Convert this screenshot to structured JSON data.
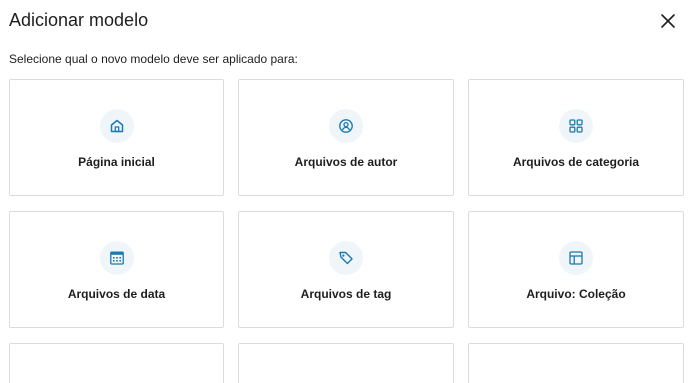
{
  "modal": {
    "title": "Adicionar modelo",
    "close_icon": "close-icon",
    "subtitle": "Selecione qual o novo modelo deve ser aplicado para:"
  },
  "colors": {
    "icon_accent": "#1a7bb0",
    "icon_background": "#eff5f9",
    "card_border": "#dcdcde",
    "text": "#1e1e1e"
  },
  "templates": [
    {
      "label": "Página inicial",
      "icon": "home-icon"
    },
    {
      "label": "Arquivos de autor",
      "icon": "user-icon"
    },
    {
      "label": "Arquivos de categoria",
      "icon": "category-icon"
    },
    {
      "label": "Arquivos de data",
      "icon": "calendar-icon"
    },
    {
      "label": "Arquivos de tag",
      "icon": "tag-icon"
    },
    {
      "label": "Arquivo: Coleção",
      "icon": "layout-icon"
    }
  ]
}
